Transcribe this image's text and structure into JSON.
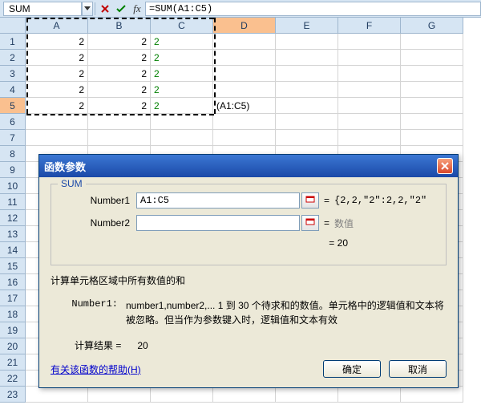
{
  "namebox": "SUM",
  "formula": "=SUM(A1:C5)",
  "columns": [
    "A",
    "B",
    "C",
    "D",
    "E",
    "F",
    "G"
  ],
  "selected_col": "D",
  "selected_row": 5,
  "row_count": 23,
  "cells": {
    "A1": "2",
    "B1": "2",
    "C1": "2",
    "A2": "2",
    "B2": "2",
    "C2": "2",
    "A3": "2",
    "B3": "2",
    "C3": "2",
    "A4": "2",
    "B4": "2",
    "C4": "2",
    "A5": "2",
    "B5": "2",
    "C5": "2",
    "D5": "(A1:C5)"
  },
  "dialog": {
    "title": "函数参数",
    "legend": "SUM",
    "param1_label": "Number1",
    "param1_value": "A1:C5",
    "param1_result": "{2,2,\"2\":2,2,\"2\"",
    "param2_label": "Number2",
    "param2_value": "",
    "param2_result": "数值",
    "total_label": "= 20",
    "desc": "计算单元格区域中所有数值的和",
    "paramdesc_name": "Number1:",
    "paramdesc_text": "number1,number2,... 1 到 30 个待求和的数值。单元格中的逻辑值和文本将被忽略。但当作为参数键入时，逻辑值和文本有效",
    "result_label": "计算结果 =",
    "result_value": "20",
    "help_link": "有关该函数的帮助(H)",
    "ok": "确定",
    "cancel": "取消"
  }
}
